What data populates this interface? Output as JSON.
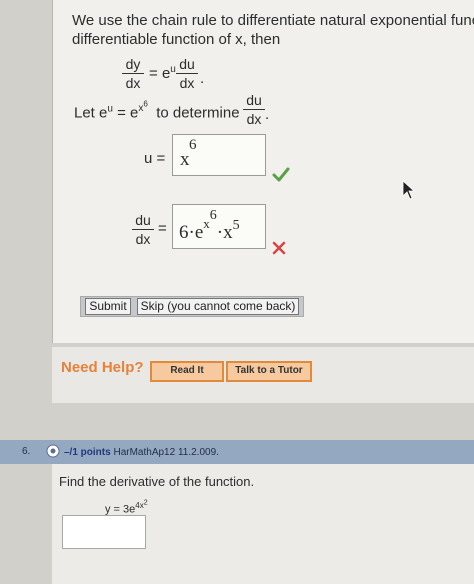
{
  "question5": {
    "intro_line1": "We use the chain rule to differentiate natural exponential functio",
    "intro_line2": "differentiable function of x, then",
    "formula": {
      "lhs_num": "dy",
      "lhs_den": "dx",
      "equals": "=",
      "exp_base": "e",
      "exp_power": "u",
      "rhs_num": "du",
      "rhs_den": "dx",
      "period": "."
    },
    "let_text_a": "Let e",
    "let_sup_u": "u",
    "let_text_b": "= e",
    "let_sup_x6_base": "x",
    "let_sup_x6_exp": "6",
    "let_text_c": "to determine",
    "let_frac_num": "du",
    "let_frac_den": "dx",
    "let_period": ".",
    "u_label": "u =",
    "u_answer_base": "x",
    "u_answer_exp": "6",
    "u_status": "correct",
    "dudx_num": "du",
    "dudx_den": "dx",
    "dudx_equals": "=",
    "dudx_answer": {
      "coef": "6",
      "dot1": "·",
      "e": "e",
      "e_sup_base": "x",
      "e_sup_exp": "6",
      "dot2": "·",
      "x": "x",
      "x_exp": "5"
    },
    "dudx_status": "incorrect",
    "submit_label": "Submit",
    "skip_label": "Skip (you cannot come back)"
  },
  "help": {
    "need_help": "Need Help?",
    "read_it": "Read It",
    "talk_tutor": "Talk to a Tutor"
  },
  "question6": {
    "number": "6.",
    "points": "–/1 points",
    "ref": "HarMathAp12 11.2.009.",
    "prompt": "Find the derivative of the function.",
    "fn_lhs": "y = 3e",
    "fn_exp": "4x",
    "fn_exp_sq": "2"
  },
  "colors": {
    "check": "#5aa046",
    "cross": "#d64545",
    "need_help": "#e6823a",
    "header": "#95a8c2"
  }
}
